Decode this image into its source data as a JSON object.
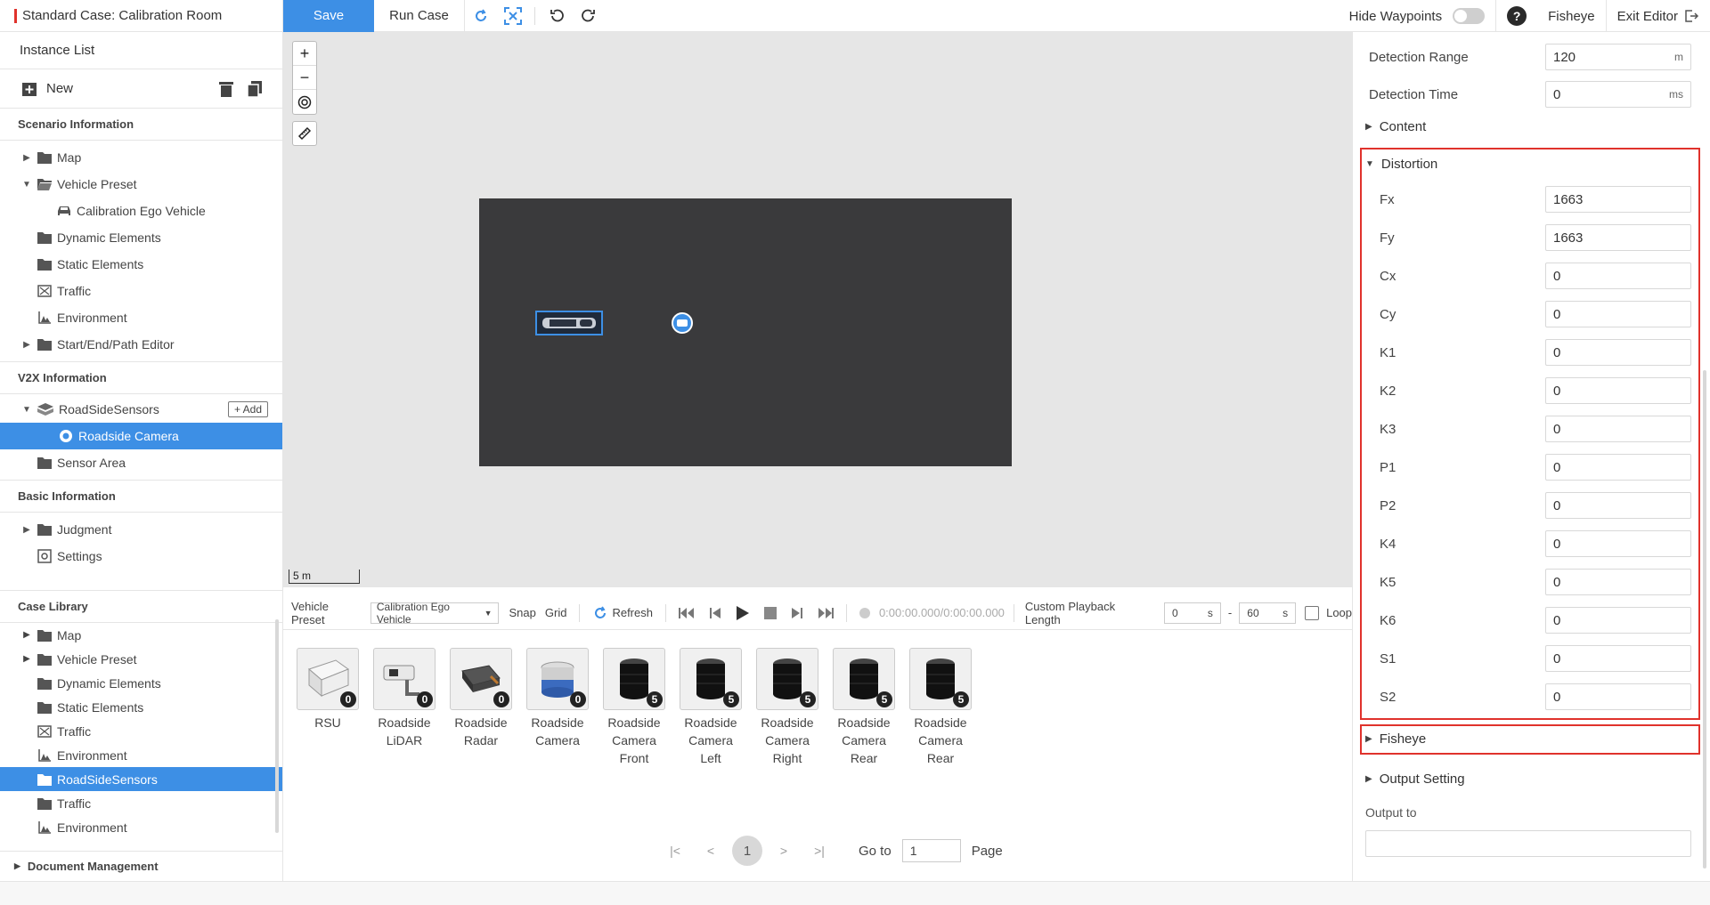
{
  "app": {
    "case_title": "Standard Case: Calibration Room",
    "save_label": "Save",
    "run_label": "Run Case",
    "hide_waypoints_label": "Hide Waypoints",
    "fisheye_label": "Fisheye",
    "exit_label": "Exit Editor"
  },
  "colors": {
    "accent": "#3d8fe5",
    "highlight_box": "#e0322c",
    "map_dark": "#3a3a3c"
  },
  "sidebar": {
    "instance_list_title": "Instance List",
    "new_label": "New",
    "scenario_title": "Scenario Information",
    "scenario_items": [
      {
        "label": "Map",
        "icon": "folder-icon",
        "arrow": "right"
      },
      {
        "label": "Vehicle Preset",
        "icon": "folder-open-icon",
        "arrow": "down"
      },
      {
        "label": "Calibration Ego Vehicle",
        "icon": "car-icon",
        "arrow": ""
      },
      {
        "label": "Dynamic Elements",
        "icon": "folder-icon",
        "arrow": ""
      },
      {
        "label": "Static Elements",
        "icon": "folder-icon",
        "arrow": ""
      },
      {
        "label": "Traffic",
        "icon": "traffic-icon",
        "arrow": ""
      },
      {
        "label": "Environment",
        "icon": "environment-icon",
        "arrow": ""
      },
      {
        "label": "Start/End/Path Editor",
        "icon": "folder-icon",
        "arrow": "right"
      }
    ],
    "v2x_title": "V2X Information",
    "v2x_items": [
      {
        "label": "RoadSideSensors",
        "icon": "sensor-group-icon",
        "arrow": "down"
      },
      {
        "label": "Roadside Camera",
        "icon": "camera-circle-icon",
        "arrow": ""
      },
      {
        "label": "Sensor Area",
        "icon": "folder-icon",
        "arrow": ""
      }
    ],
    "add_label": "+ Add",
    "basic_title": "Basic Information",
    "basic_items": [
      {
        "label": "Judgment",
        "icon": "folder-icon",
        "arrow": "right"
      },
      {
        "label": "Settings",
        "icon": "settings-icon",
        "arrow": ""
      }
    ],
    "library_title": "Case Library",
    "library_items": [
      {
        "label": "Map",
        "icon": "folder-icon",
        "arrow": "right"
      },
      {
        "label": "Vehicle Preset",
        "icon": "folder-icon",
        "arrow": "right"
      },
      {
        "label": "Dynamic Elements",
        "icon": "folder-icon",
        "arrow": ""
      },
      {
        "label": "Static Elements",
        "icon": "folder-icon",
        "arrow": ""
      },
      {
        "label": "Traffic",
        "icon": "traffic-icon",
        "arrow": ""
      },
      {
        "label": "Environment",
        "icon": "environment-icon",
        "arrow": ""
      },
      {
        "label": "RoadSideSensors",
        "icon": "folder-icon",
        "arrow": ""
      },
      {
        "label": "Traffic",
        "icon": "folder-icon",
        "arrow": ""
      },
      {
        "label": "Environment",
        "icon": "environment-icon",
        "arrow": ""
      }
    ],
    "doc_label": "Document Management"
  },
  "canvas": {
    "zoom_in": "+",
    "zoom_out": "−",
    "scale_label": "5 m"
  },
  "playback": {
    "vehicle_preset_label": "Vehicle Preset",
    "vehicle_preset_value": "Calibration Ego Vehicle",
    "snap_label": "Snap",
    "grid_label": "Grid",
    "refresh_label": "Refresh",
    "time_label": "0:00:00.000/0:00:00.000",
    "custom_length_label": "Custom Playback Length",
    "start_value": "0",
    "end_value": "60",
    "unit": "s",
    "dash": "-",
    "loop_label": "Loop"
  },
  "sensors": [
    {
      "name": "RSU",
      "count": "0"
    },
    {
      "name": "Roadside LiDAR",
      "count": "0"
    },
    {
      "name": "Roadside Radar",
      "count": "0"
    },
    {
      "name": "Roadside Camera",
      "count": "0"
    },
    {
      "name": "Roadside Camera Front",
      "count": "5"
    },
    {
      "name": "Roadside Camera Left",
      "count": "5"
    },
    {
      "name": "Roadside Camera Right",
      "count": "5"
    },
    {
      "name": "Roadside Camera Rear",
      "count": "5"
    },
    {
      "name": "Roadside Camera Rear",
      "count": "5"
    }
  ],
  "pagination": {
    "current": "1",
    "goto_label": "Go to",
    "goto_value": "1",
    "page_label": "Page"
  },
  "panel": {
    "detection_range_label": "Detection Range",
    "detection_range_value": "120",
    "detection_range_unit": "m",
    "detection_time_label": "Detection Time",
    "detection_time_value": "0",
    "detection_time_unit": "ms",
    "content_label": "Content",
    "distortion_label": "Distortion",
    "distortion_params": [
      {
        "label": "Fx",
        "value": "1663"
      },
      {
        "label": "Fy",
        "value": "1663"
      },
      {
        "label": "Cx",
        "value": "0"
      },
      {
        "label": "Cy",
        "value": "0"
      },
      {
        "label": "K1",
        "value": "0"
      },
      {
        "label": "K2",
        "value": "0"
      },
      {
        "label": "K3",
        "value": "0"
      },
      {
        "label": "P1",
        "value": "0"
      },
      {
        "label": "P2",
        "value": "0"
      },
      {
        "label": "K4",
        "value": "0"
      },
      {
        "label": "K5",
        "value": "0"
      },
      {
        "label": "K6",
        "value": "0"
      },
      {
        "label": "S1",
        "value": "0"
      },
      {
        "label": "S2",
        "value": "0"
      }
    ],
    "fisheye_label": "Fisheye",
    "output_setting_label": "Output Setting",
    "output_to_label": "Output to",
    "output_to_value": ""
  }
}
